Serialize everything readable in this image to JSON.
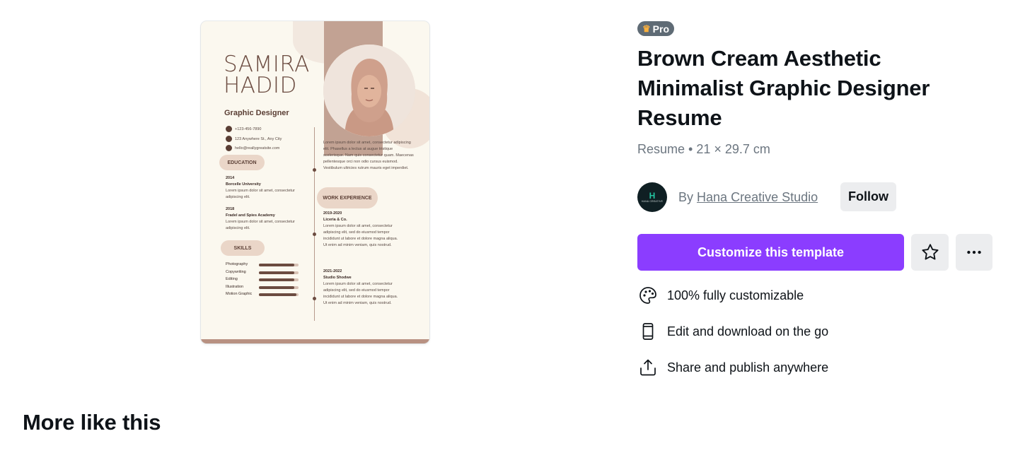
{
  "preview": {
    "name_line1": "SAMIRA",
    "name_line2": "HADID",
    "role": "Graphic Designer",
    "phone": "+123-456-7890",
    "address": "123 Anywhere St., Any City",
    "email": "hello@reallygreatsite.com",
    "education_label": "EDUCATION",
    "edu1_year": "2014",
    "edu1_school": "Borcelle University",
    "edu1_text": "Lorem ipsum dolor sit amet, consectetur adipiscing elit.",
    "edu2_year": "2018",
    "edu2_school": "Fradel and Spies Academy",
    "edu2_text": "Lorem ipsum dolor sit amet, consectetur adipiscing elit.",
    "skills_label": "SKILLS",
    "skills": [
      {
        "label": "Photography",
        "level": 0.9
      },
      {
        "label": "Copywriting",
        "level": 0.9
      },
      {
        "label": "Editing",
        "level": 0.9
      },
      {
        "label": "Illustration",
        "level": 0.9
      },
      {
        "label": "Motion Graphic",
        "level": 0.95
      }
    ],
    "about": "Lorem ipsum dolor sit amet, consectetur adipiscing elit. Phasellus a lectus at augue tristique scelerisque. Nam quis consectetur quam. Maecenas pellentesque orci non odio cursus euismod. Vestibulum ultricies rutrum mauris eget imperdiet.",
    "work_label": "WORK EXPERIENCE",
    "job1_years": "2019-2020",
    "job1_company": "Liceria & Co.",
    "job1_text": "Lorem ipsum dolor sit amet, consectetur adipiscing elit, sed do eiusmod tempor incididunt ut labore et dolore magna aliqua. Ut enim ad minim veniam, quis nostrud.",
    "job2_years": "2021-2022",
    "job2_company": "Studio Shodwe",
    "job2_text": "Lorem ipsum dolor sit amet, consectetur adipiscing elit, sed do eiusmod tempor incididunt ut labore et dolore magna aliqua. Ut enim ad minim veniam, quis nostrud."
  },
  "info": {
    "badge": "Pro",
    "title": "Brown Cream Aesthetic Minimalist Graphic Designer Resume",
    "meta": "Resume • 21 × 29.7 cm",
    "by_prefix": "By",
    "creator_name": "Hana Creative Studio",
    "avatar_letter": "H",
    "avatar_text": "HANA CREATIVE",
    "follow": "Follow",
    "cta": "Customize this template",
    "features": [
      {
        "icon": "palette-icon",
        "label": "100% fully customizable"
      },
      {
        "icon": "mobile-phone-icon",
        "label": "Edit and download on the go"
      },
      {
        "icon": "share-upload-icon",
        "label": "Share and publish anywhere"
      }
    ]
  },
  "section": {
    "more_like_this": "More like this"
  },
  "colors": {
    "accent": "#8b3dff",
    "pro_badge": "#5f6b75",
    "crown": "#ffb13b",
    "resume_bg": "#fbf8ef",
    "resume_brown": "#6b4b40"
  }
}
